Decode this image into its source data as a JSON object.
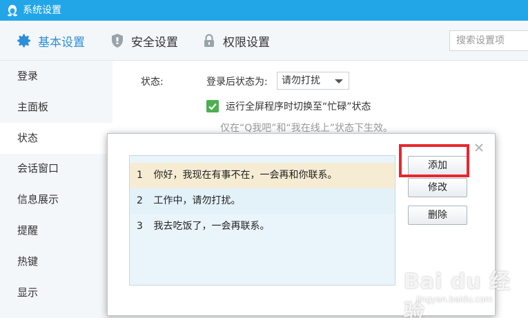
{
  "window": {
    "title": "系统设置",
    "accent": "#22a6e8"
  },
  "tabs": [
    {
      "label": "基本设置",
      "icon": "gear-icon",
      "active": true
    },
    {
      "label": "安全设置",
      "icon": "shield-icon",
      "active": false
    },
    {
      "label": "权限设置",
      "icon": "lock-icon",
      "active": false
    }
  ],
  "search": {
    "placeholder": "搜索设置项",
    "value": ""
  },
  "sidebar": {
    "items": [
      {
        "label": "登录"
      },
      {
        "label": "主面板"
      },
      {
        "label": "状态",
        "active": true
      },
      {
        "label": "会话窗口"
      },
      {
        "label": "信息展示"
      },
      {
        "label": "提醒"
      },
      {
        "label": "热键"
      },
      {
        "label": "显示"
      }
    ]
  },
  "status_section": {
    "label": "状态:",
    "after_login_label": "登录后状态为:",
    "selected_status": "请勿打扰",
    "checkbox_label": "运行全屏程序时切换至“忙碌”状态",
    "checkbox_checked": true,
    "checkbox_color": "#4caf50",
    "hint": "仅在“Q我吧”和“我在线上”状态下生效。"
  },
  "dialog": {
    "replies": [
      {
        "num": "1",
        "text": "你好，我现在有事不在，一会再和你联系。"
      },
      {
        "num": "2",
        "text": "工作中，请勿打扰。"
      },
      {
        "num": "3",
        "text": "我去吃饭了，一会再联系。"
      }
    ],
    "buttons": {
      "add": "添加",
      "edit": "修改",
      "delete": "删除"
    },
    "highlight_color": "#e8262c"
  },
  "watermark": {
    "main": "Bai du 经验",
    "sub": "jingyan.baidu.com"
  }
}
